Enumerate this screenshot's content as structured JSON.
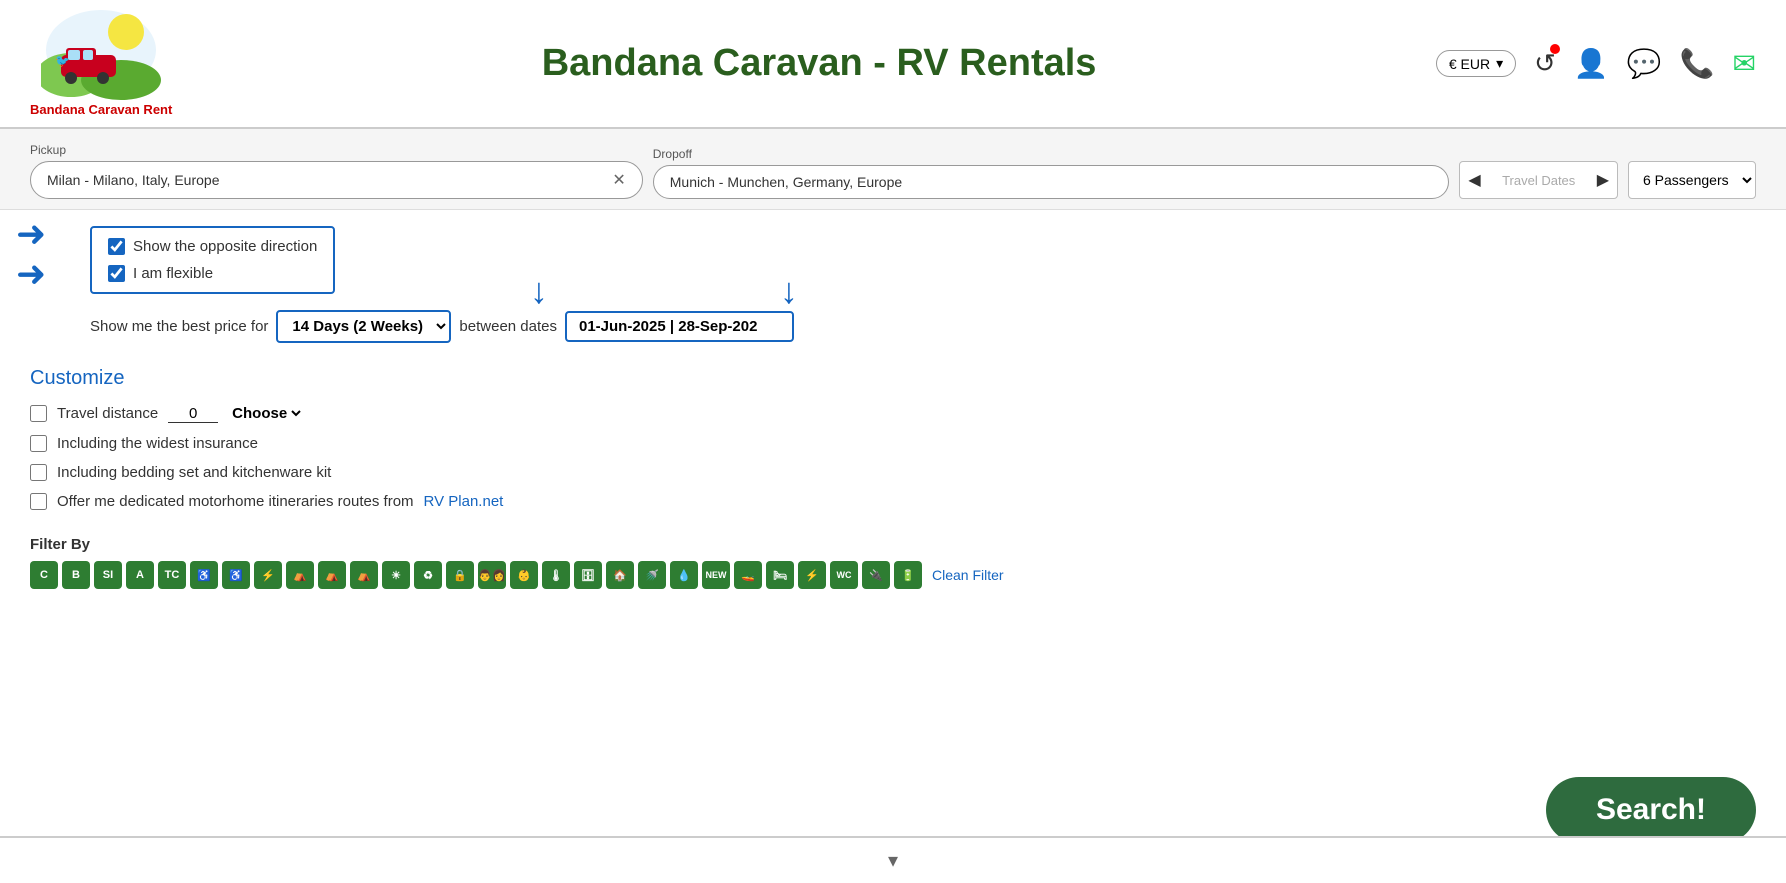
{
  "header": {
    "site_title": "Bandana Caravan - RV Rentals",
    "logo_subtitle": "Bandana Caravan Rent",
    "currency": "€ EUR",
    "currency_dropdown": "▾"
  },
  "search": {
    "pickup_label": "Pickup",
    "pickup_value": "Milan - Milano, Italy, Europe",
    "dropoff_label": "Dropoff",
    "dropoff_value": "Munich - Munchen, Germany, Europe",
    "travel_dates_placeholder": "Travel Dates",
    "passengers_value": "6 Passengers"
  },
  "options": {
    "show_opposite_label": "Show the opposite direction",
    "flexible_label": "I am flexible",
    "best_price_prefix": "Show me the best price for",
    "best_price_between": "between dates",
    "duration_value": "14 Days (2 Weeks)",
    "dates_range_value": "01-Jun-2025 | 28-Sep-202"
  },
  "customize": {
    "title": "Customize",
    "travel_distance_label": "Travel distance",
    "travel_distance_value": "0",
    "choose_label": "Choose",
    "widest_insurance_label": "Including the widest insurance",
    "bedding_label": "Including bedding set and kitchenware kit",
    "itineraries_prefix": "Offer me dedicated motorhome itineraries routes from",
    "rv_plan_link": "RV Plan.net"
  },
  "filter": {
    "title": "Filter By",
    "icons": [
      "C",
      "B",
      "SI",
      "A",
      "TC",
      "♿",
      "♿",
      "⚡",
      "🏕",
      "🏕",
      "🏕",
      "☀",
      "🔄",
      "🔒",
      "👨‍👩",
      "👶",
      "🌡",
      "🗄",
      "🏠",
      "🚿",
      "💧",
      "NEW",
      "🚤",
      "🛏",
      "⚡",
      "WC",
      "🔌",
      "🔋"
    ],
    "icon_labels": [
      "C",
      "B",
      "SI",
      "A",
      "TC",
      "",
      "",
      "",
      "",
      "",
      "",
      "",
      "",
      "",
      "",
      "",
      "",
      "",
      "",
      "",
      "",
      "NEW",
      "",
      "",
      "",
      "WC",
      "",
      ""
    ],
    "clean_filter_label": "Clean Filter"
  },
  "actions": {
    "search_label": "Search!"
  }
}
